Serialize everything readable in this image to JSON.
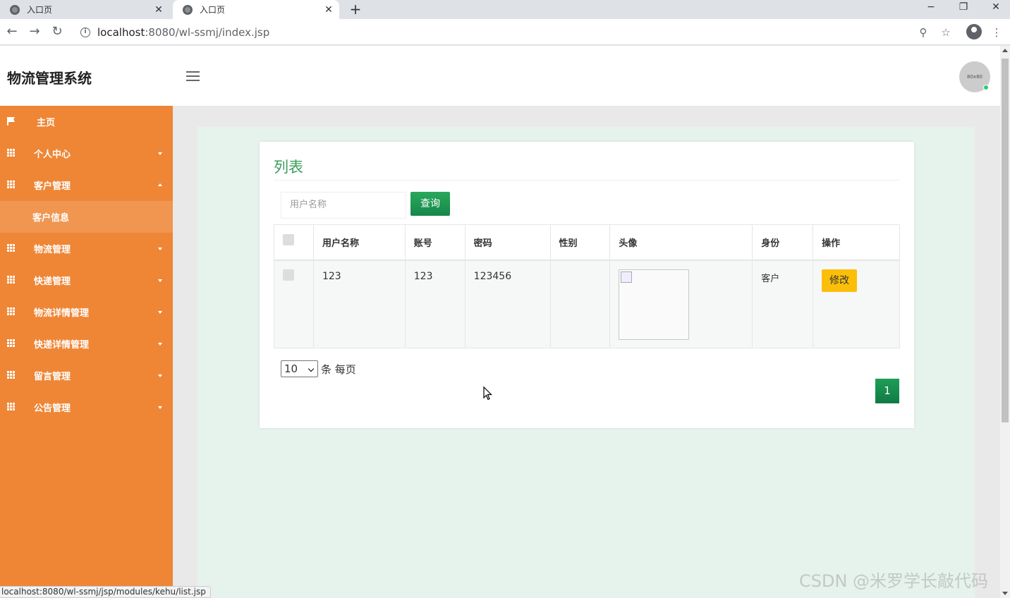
{
  "browser": {
    "tabs": [
      {
        "title": "入口页",
        "active": false
      },
      {
        "title": "入口页",
        "active": true
      }
    ],
    "url_host": "localhost",
    "url_rest": ":8080/wl-ssmj/index.jsp",
    "window_controls": {
      "minimize": "−",
      "restore": "❐",
      "close": "✕"
    },
    "status_url": "localhost:8080/wl-ssmj/jsp/modules/kehu/list.jsp"
  },
  "header": {
    "brand": "物流管理系统",
    "avatar_text": "80x80",
    "online_color": "#2ecc71"
  },
  "sidebar": {
    "bg_color": "#ee8636",
    "items": [
      {
        "label": "主页",
        "icon": "flag-icon",
        "caret": "none"
      },
      {
        "label": "个人中心",
        "icon": "grid-icon",
        "caret": "down"
      },
      {
        "label": "客户管理",
        "icon": "grid-icon",
        "caret": "up",
        "expanded": true,
        "children": [
          {
            "label": "客户信息"
          }
        ]
      },
      {
        "label": "物流管理",
        "icon": "grid-icon",
        "caret": "down"
      },
      {
        "label": "快递管理",
        "icon": "grid-icon",
        "caret": "down"
      },
      {
        "label": "物流详情管理",
        "icon": "grid-icon",
        "caret": "down"
      },
      {
        "label": "快递详情管理",
        "icon": "grid-icon",
        "caret": "down"
      },
      {
        "label": "留言管理",
        "icon": "grid-icon",
        "caret": "down"
      },
      {
        "label": "公告管理",
        "icon": "grid-icon",
        "caret": "down"
      }
    ]
  },
  "main": {
    "title": "列表",
    "title_color": "#3a9d5d",
    "search": {
      "placeholder": "用户名称",
      "value": "",
      "button": "查询"
    },
    "table": {
      "columns": [
        "",
        "用户名称",
        "账号",
        "密码",
        "性别",
        "头像",
        "身份",
        "操作"
      ],
      "rows": [
        {
          "username": "123",
          "account": "123",
          "password": "123456",
          "gender": "",
          "avatar": "broken-image",
          "role": "客户",
          "action": "修改"
        }
      ]
    },
    "pagination": {
      "page_size": "10",
      "page_size_suffix": "条 每页",
      "current_page": "1"
    }
  },
  "watermark": "CSDN @米罗学长敲代码"
}
